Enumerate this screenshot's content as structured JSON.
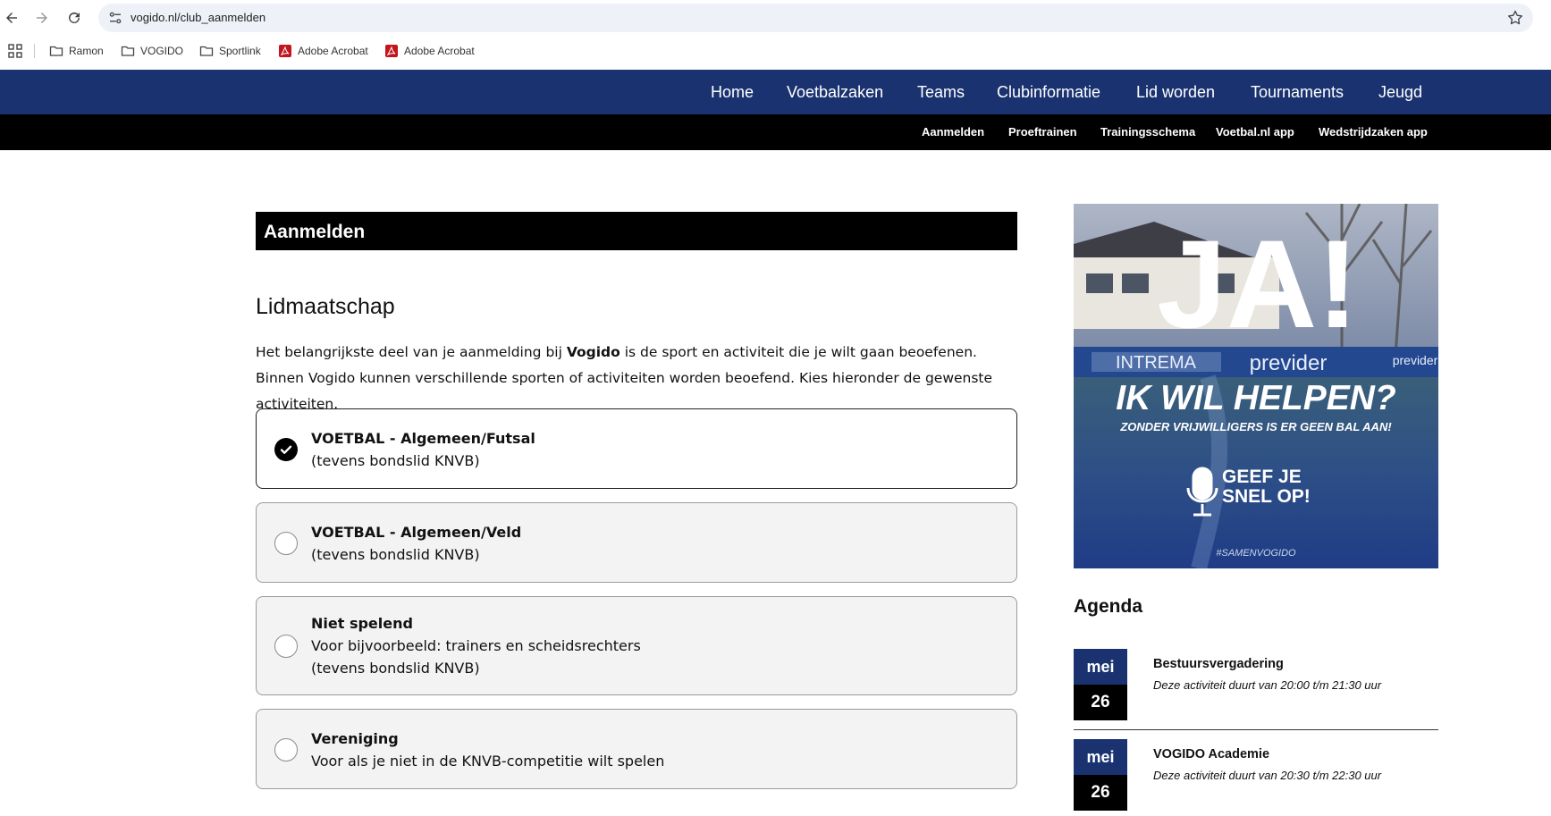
{
  "browser": {
    "url": "vogido.nl/club_aanmelden",
    "bookmarks": [
      "Ramon",
      "VOGIDO",
      "Sportlink",
      "Adobe Acrobat",
      "Adobe Acrobat"
    ]
  },
  "main_nav": {
    "items": [
      "Home",
      "Voetbalzaken",
      "Teams",
      "Clubinformatie",
      "Lid worden",
      "Tournaments",
      "Jeugd"
    ]
  },
  "sub_nav": {
    "items": [
      "Aanmelden",
      "Proeftrainen",
      "Trainingsschema",
      "Voetbal.nl app",
      "Wedstrijdzaken app"
    ]
  },
  "page": {
    "title": "Aanmelden",
    "section_title": "Lidmaatschap",
    "intro_part1": "Het belangrijkste deel van je aanmelding bij ",
    "intro_bold": "Vogido",
    "intro_part2": " is de sport en activiteit die je wilt gaan beoefenen. Binnen Vogido kunnen verschillende sporten of activiteiten worden beoefend. Kies hieronder de gewenste activiteiten."
  },
  "options": [
    {
      "title": "VOETBAL - Algemeen/Futsal",
      "lines": [
        "(tevens bondslid KNVB)"
      ],
      "selected": true
    },
    {
      "title": "VOETBAL - Algemeen/Veld",
      "lines": [
        "(tevens bondslid KNVB)"
      ],
      "selected": false
    },
    {
      "title": "Niet spelend",
      "lines": [
        "Voor bijvoorbeeld: trainers en scheidsrechters",
        "(tevens bondslid KNVB)"
      ],
      "selected": false
    },
    {
      "title": "Vereniging",
      "lines": [
        "Voor als je niet in de KNVB-competitie wilt spelen"
      ],
      "selected": false
    }
  ],
  "banner": {
    "headline": "JA!",
    "subheadline": "IK WIL HELPEN?",
    "tagline": "ZONDER VRIJWILLIGERS IS ER GEEN BAL AAN!",
    "cta_line1": "GEEF JE",
    "cta_line2": "SNEL OP!",
    "hashtag": "#SAMENVOGIDO",
    "board_text_1": "INTREMA",
    "board_text_2": "previder",
    "board_text_3": "previder"
  },
  "agenda": {
    "title": "Agenda",
    "items": [
      {
        "month": "mei",
        "day": "26",
        "name": "Bestuursvergadering",
        "desc": "Deze activiteit duurt van 20:00 t/m 21:30 uur"
      },
      {
        "month": "mei",
        "day": "26",
        "name": "VOGIDO Academie",
        "desc": "Deze activiteit duurt van 20:30 t/m 22:30 uur"
      }
    ]
  },
  "colors": {
    "nav_blue": "#1a3370",
    "sub_nav_black": "#000000",
    "banner_blue": "#24447f"
  }
}
